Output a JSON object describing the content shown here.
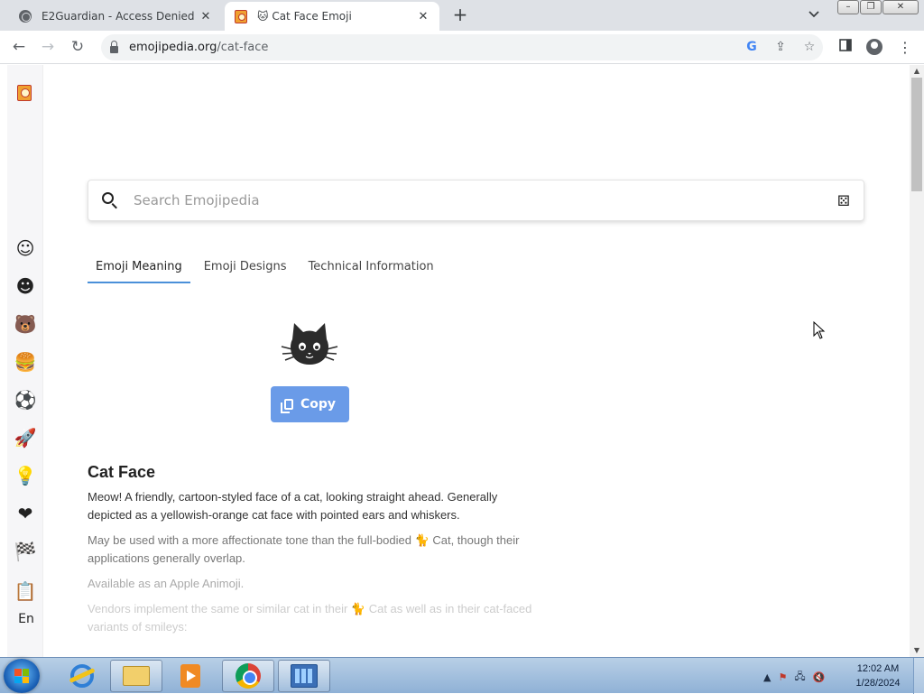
{
  "browser": {
    "tabs": [
      {
        "title": "E2Guardian - Access Denied",
        "icon": "globe-icon",
        "active": false
      },
      {
        "title": "🐱 Cat Face Emoji",
        "icon": "emojipedia-logo-icon",
        "active": true
      }
    ],
    "new_tab": "+",
    "tab_menu": "⌄",
    "window_controls": {
      "minimize": "–",
      "restore": "❐",
      "close": "✕"
    },
    "url_host": "emojipedia.org",
    "url_path": "/cat-face",
    "nav": {
      "back": "←",
      "forward": "→",
      "reload": "↻"
    }
  },
  "sidebar": {
    "categories": [
      {
        "name": "smileys",
        "glyph": "☺"
      },
      {
        "name": "people",
        "glyph": "☻"
      },
      {
        "name": "animals",
        "glyph": "🐻"
      },
      {
        "name": "food",
        "glyph": "🍔"
      },
      {
        "name": "activities",
        "glyph": "⚽"
      },
      {
        "name": "travel",
        "glyph": "🚀"
      },
      {
        "name": "objects",
        "glyph": "💡"
      },
      {
        "name": "symbols",
        "glyph": "❤"
      },
      {
        "name": "flags",
        "glyph": "🏁"
      },
      {
        "name": "collections",
        "glyph": "📋"
      }
    ],
    "language": "En"
  },
  "search": {
    "placeholder": "Search Emojipedia",
    "random_icon": "dice-icon"
  },
  "page_tabs": [
    {
      "label": "Emoji Meaning",
      "active": true
    },
    {
      "label": "Emoji Designs",
      "active": false
    },
    {
      "label": "Technical Information",
      "active": false
    }
  ],
  "emoji": {
    "copy_label": "Copy",
    "title": "Cat Face",
    "paragraphs": [
      "Meow! A friendly, cartoon-styled face of a cat, looking straight ahead. Generally depicted as a yellowish-orange cat face with pointed ears and whiskers.",
      "May be used with a more affectionate tone than the full-bodied 🐈 Cat, though their applications generally overlap.",
      "Available as an Apple Animoji.",
      "Vendors implement the same or similar cat in their 🐈 Cat as well as in their cat-faced variants of smileys:"
    ]
  },
  "taskbar": {
    "apps": [
      "internet-explorer",
      "windows-explorer",
      "media-player",
      "chrome",
      "control-panel"
    ],
    "clock_time": "12:02 AM",
    "clock_date": "1/28/2024",
    "tray": {
      "expand": "▲",
      "flag": "⚑",
      "network": "🖧",
      "volume": "🔇"
    }
  }
}
